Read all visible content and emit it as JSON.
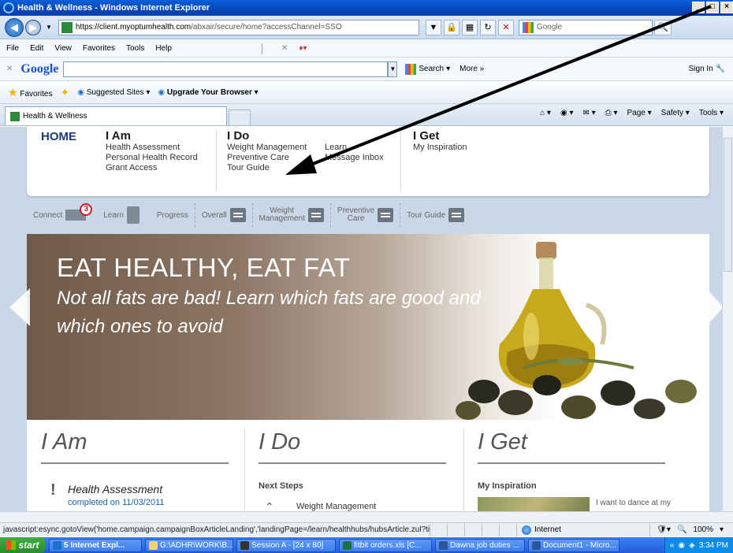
{
  "window": {
    "title": "Health & Wellness - Windows Internet Explorer",
    "buttons": [
      "_",
      "□",
      "×"
    ]
  },
  "address": {
    "url_prefix": "https://client.",
    "url_domain": "myoptumhealth.com",
    "url_path": "/abxair/secure/home?accessChannel=SSO",
    "search_placeholder": "Google"
  },
  "menu": {
    "items": [
      "File",
      "Edit",
      "View",
      "Favorites",
      "Tools",
      "Help"
    ]
  },
  "googlebar": {
    "logo": "Google",
    "search_label": "Search",
    "more_label": "More »",
    "signin_label": "Sign In"
  },
  "favorites": {
    "favorites_label": "Favorites",
    "suggested_label": "Suggested Sites",
    "upgrade_label": "Upgrade Your Browser"
  },
  "tabs": {
    "active_label": "Health & Wellness",
    "commands": [
      "Page",
      "Safety",
      "Tools"
    ]
  },
  "site": {
    "home_label": "HOME",
    "columns": [
      {
        "heading": "I Am",
        "links": [
          "Health Assessment",
          "Personal Health Record",
          "Grant Access"
        ]
      },
      {
        "heading": "I Do",
        "links": [
          "Weight Management",
          "Preventive Care",
          "Tour Guide"
        ]
      },
      {
        "heading": "",
        "links": [
          "Learn",
          "Message Inbox"
        ]
      },
      {
        "heading": "I Get",
        "links": [
          "My Inspiration"
        ]
      }
    ],
    "toolstrip": {
      "connect": "Connect",
      "connect_count": "3",
      "learn": "Learn",
      "progress": "Progress",
      "overall": "Overall",
      "weight_l1": "Weight",
      "weight_l2": "Management",
      "prev_l1": "Preventive",
      "prev_l2": "Care",
      "tour": "Tour Guide"
    },
    "hero": {
      "title": "EAT HEALTHY, EAT FAT",
      "subtitle": "Not all fats are bad! Learn which fats are good and which ones to avoid"
    },
    "cards": {
      "i_am": {
        "heading": "I Am",
        "item_title": "Health Assessment",
        "item_date": "completed on 11/03/2011"
      },
      "i_do": {
        "heading": "I Do",
        "section": "Next Steps",
        "item": "Weight Management"
      },
      "i_get": {
        "heading": "I Get",
        "section": "My Inspiration",
        "quote": "I want to dance at my"
      }
    }
  },
  "status": {
    "text": "javascript:esync.gotoView('home.campaign.campaignBoxArticleLanding','landingPage=/learn/healthhubs/hubsArticle.zul?titl",
    "zone": "Internet",
    "zoom": "100%"
  },
  "taskbar": {
    "start": "start",
    "tasks": [
      "5 Internet Expl...",
      "G:\\ADHR\\WORK\\B...",
      "Session A - [24 x 80]",
      "fitbit orders.xls [C...",
      "Dawna job duties ...",
      "Document1 - Micro..."
    ],
    "clock": "3:34 PM"
  }
}
